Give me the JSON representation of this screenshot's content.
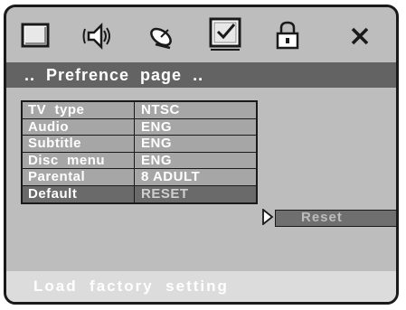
{
  "toolbar": {
    "icons": [
      "monitor-icon",
      "speaker-icon",
      "satellite-dish-icon",
      "checkbox-icon",
      "padlock-icon",
      "close-icon"
    ],
    "selected": "checkbox-icon"
  },
  "page_title": "..  Prefrence  page  ..",
  "menu": {
    "rows": [
      {
        "label": "TV  type",
        "value": "NTSC"
      },
      {
        "label": "Audio",
        "value": "ENG"
      },
      {
        "label": "Subtitle",
        "value": "ENG"
      },
      {
        "label": "Disc  menu",
        "value": "ENG"
      },
      {
        "label": "Parental",
        "value": "8 ADULT"
      },
      {
        "label": "Default",
        "value": "RESET"
      }
    ],
    "selected_row": "Default"
  },
  "submenu": {
    "option": "Reset"
  },
  "status": {
    "help_text": "Load  factory  setting"
  },
  "colors": {
    "panel": "#bdbdbd",
    "header": "#636363",
    "highlight": "#6a6a6a",
    "footer": "#dcdcdc"
  }
}
